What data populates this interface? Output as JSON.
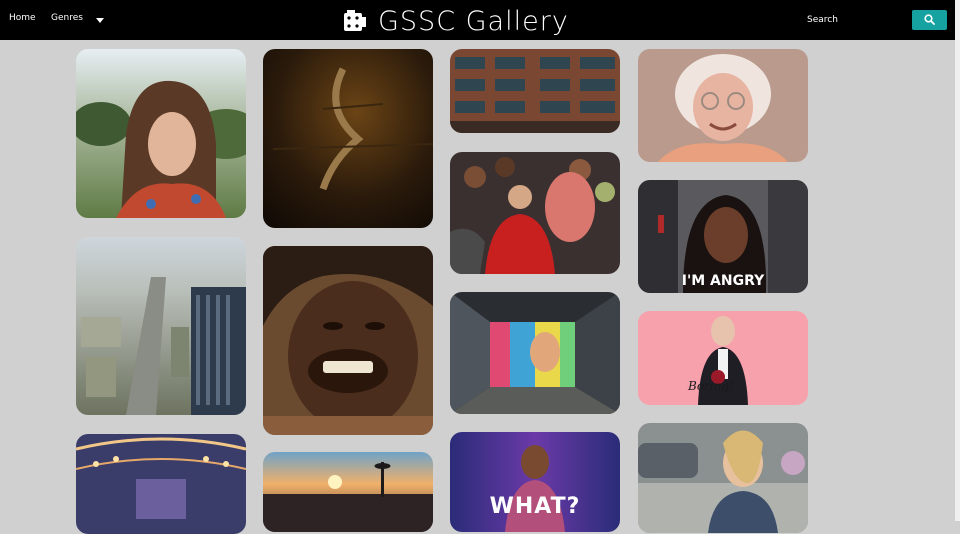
{
  "nav": {
    "home_label": "Home",
    "genres_label": "Genres",
    "brand_title": "GSSC Gallery",
    "search_placeholder": "Search"
  },
  "gallery": {
    "tiles": [
      {
        "name": "tile-woman-portrait-field"
      },
      {
        "name": "tile-knife-dark-wood"
      },
      {
        "name": "tile-building-windows"
      },
      {
        "name": "tile-smiling-grandma"
      },
      {
        "name": "tile-city-aerial-street"
      },
      {
        "name": "tile-laughing-man-closeup"
      },
      {
        "name": "tile-crowd-red-hoodie"
      },
      {
        "name": "tile-angry-woman",
        "caption": "I'M ANGRY"
      },
      {
        "name": "tile-graffiti-mural-room"
      },
      {
        "name": "tile-man-boring-pink",
        "caption": "Boring!"
      },
      {
        "name": "tile-lights-interior"
      },
      {
        "name": "tile-sunset-skyline"
      },
      {
        "name": "tile-woman-what-stage",
        "caption": "WHAT?"
      },
      {
        "name": "tile-woman-parking-lot"
      }
    ]
  },
  "colors": {
    "page_background": "#d0d0d0",
    "navbar": "#000000",
    "search_button": "#17a2a2",
    "tile_pink": "#f7a1ac"
  },
  "icons": {
    "brand": "film-roll-icon",
    "search": "magnifier-icon",
    "genres_dropdown": "caret-down-icon"
  }
}
